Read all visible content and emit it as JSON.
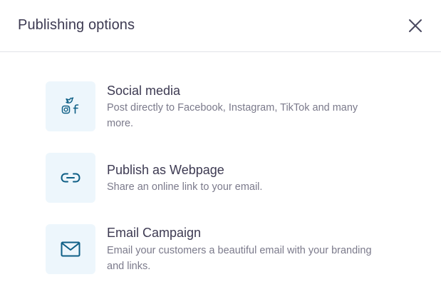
{
  "dialog": {
    "title": "Publishing options",
    "close_icon": "close-icon"
  },
  "options": [
    {
      "title": "Social media",
      "description": "Post directly to Facebook, Instagram, TikTok and many more.",
      "icon": "social-media-icon"
    },
    {
      "title": "Publish as Webpage",
      "description": "Share an online link to your email.",
      "icon": "link-icon"
    },
    {
      "title": "Email Campaign",
      "description": "Email your customers a beautiful email with your branding and links.",
      "icon": "mail-icon"
    }
  ],
  "colors": {
    "icon_accent": "#0e5f86",
    "tile_background": "#edf6fc",
    "title_text": "#3d3a52",
    "description_text": "#7b7a8b",
    "divider": "#e2e3e8"
  }
}
